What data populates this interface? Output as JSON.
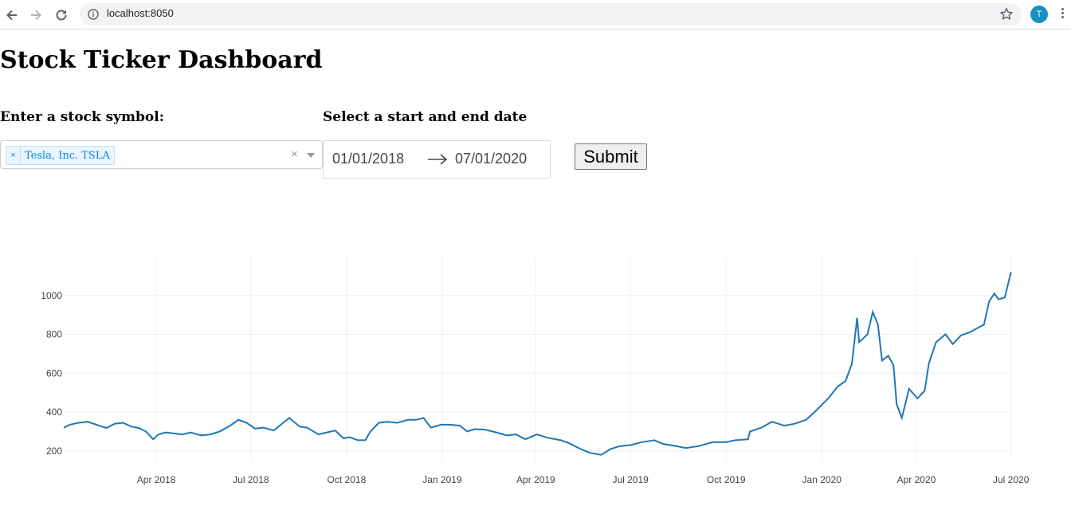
{
  "browser": {
    "url": "localhost:8050",
    "avatar_letter": "T",
    "icons": [
      "back-arrow-icon",
      "forward-arrow-icon",
      "reload-icon",
      "info-icon",
      "star-icon",
      "menu-dots-icon"
    ]
  },
  "page": {
    "title": "Stock Ticker Dashboard",
    "symbol_label": "Enter a stock symbol:",
    "date_label": "Select a start and end date",
    "selected_symbol": "Tesla, Inc. TSLA",
    "tag_remove": "×",
    "clear_glyph": "×",
    "start_date": "01/01/2018",
    "end_date": "07/01/2020",
    "submit_label": "Submit"
  },
  "chart_data": {
    "type": "line",
    "title": "",
    "xlabel": "",
    "ylabel": "",
    "line_color": "#1f77b4",
    "grid": true,
    "xlim": [
      "2018-01-02",
      "2020-07-02"
    ],
    "ylim": [
      150,
      1200
    ],
    "x_ticks": [
      "Apr 2018",
      "Jul 2018",
      "Oct 2018",
      "Jan 2019",
      "Apr 2019",
      "Jul 2019",
      "Oct 2019",
      "Jan 2020",
      "Apr 2020",
      "Jul 2020"
    ],
    "x_tick_dates": [
      "2018-04-01",
      "2018-07-01",
      "2018-10-01",
      "2019-01-01",
      "2019-04-01",
      "2019-07-01",
      "2019-10-01",
      "2020-01-01",
      "2020-04-01",
      "2020-07-01"
    ],
    "y_ticks": [
      200,
      400,
      600,
      800,
      1000
    ],
    "series": [
      {
        "x": [
          "2018-01-02",
          "2018-01-08",
          "2018-01-16",
          "2018-01-25",
          "2018-02-05",
          "2018-02-12",
          "2018-02-20",
          "2018-02-28",
          "2018-03-08",
          "2018-03-15",
          "2018-03-22",
          "2018-03-29",
          "2018-04-03",
          "2018-04-10",
          "2018-04-18",
          "2018-04-26",
          "2018-05-04",
          "2018-05-14",
          "2018-05-23",
          "2018-06-01",
          "2018-06-11",
          "2018-06-19",
          "2018-06-27",
          "2018-07-05",
          "2018-07-13",
          "2018-07-23",
          "2018-08-01",
          "2018-08-07",
          "2018-08-10",
          "2018-08-17",
          "2018-08-24",
          "2018-09-04",
          "2018-09-12",
          "2018-09-20",
          "2018-09-28",
          "2018-10-04",
          "2018-10-12",
          "2018-10-19",
          "2018-10-24",
          "2018-11-01",
          "2018-11-09",
          "2018-11-19",
          "2018-11-29",
          "2018-12-07",
          "2018-12-14",
          "2018-12-21",
          "2018-12-31",
          "2019-01-08",
          "2019-01-18",
          "2019-01-25",
          "2019-02-01",
          "2019-02-11",
          "2019-02-22",
          "2019-03-04",
          "2019-03-13",
          "2019-03-22",
          "2019-04-02",
          "2019-04-12",
          "2019-04-25",
          "2019-05-03",
          "2019-05-14",
          "2019-05-23",
          "2019-06-03",
          "2019-06-12",
          "2019-06-21",
          "2019-07-01",
          "2019-07-12",
          "2019-07-24",
          "2019-08-02",
          "2019-08-14",
          "2019-08-23",
          "2019-09-05",
          "2019-09-18",
          "2019-10-01",
          "2019-10-10",
          "2019-10-22",
          "2019-10-24",
          "2019-11-04",
          "2019-11-14",
          "2019-11-26",
          "2019-12-06",
          "2019-12-17",
          "2019-12-27",
          "2020-01-08",
          "2020-01-16",
          "2020-01-24",
          "2020-01-30",
          "2020-02-04",
          "2020-02-06",
          "2020-02-14",
          "2020-02-19",
          "2020-02-24",
          "2020-02-28",
          "2020-03-05",
          "2020-03-10",
          "2020-03-13",
          "2020-03-18",
          "2020-03-25",
          "2020-04-02",
          "2020-04-09",
          "2020-04-13",
          "2020-04-20",
          "2020-04-29",
          "2020-05-06",
          "2020-05-14",
          "2020-05-22",
          "2020-05-29",
          "2020-06-05",
          "2020-06-10",
          "2020-06-15",
          "2020-06-19",
          "2020-06-25",
          "2020-07-01"
        ],
        "y": [
          320,
          335,
          345,
          350,
          330,
          318,
          340,
          345,
          325,
          318,
          300,
          260,
          285,
          295,
          290,
          285,
          295,
          280,
          285,
          300,
          330,
          360,
          345,
          315,
          320,
          305,
          345,
          370,
          355,
          325,
          320,
          285,
          295,
          305,
          265,
          270,
          255,
          255,
          300,
          345,
          350,
          345,
          360,
          360,
          370,
          320,
          335,
          335,
          330,
          300,
          312,
          310,
          295,
          280,
          285,
          260,
          285,
          268,
          255,
          240,
          210,
          190,
          180,
          210,
          225,
          230,
          245,
          255,
          235,
          225,
          215,
          225,
          245,
          245,
          255,
          260,
          300,
          320,
          350,
          330,
          340,
          360,
          410,
          475,
          530,
          560,
          650,
          885,
          760,
          800,
          915,
          850,
          665,
          690,
          640,
          440,
          370,
          520,
          470,
          510,
          650,
          760,
          800,
          750,
          795,
          810,
          830,
          850,
          970,
          1010,
          980,
          990,
          1120
        ]
      }
    ]
  }
}
